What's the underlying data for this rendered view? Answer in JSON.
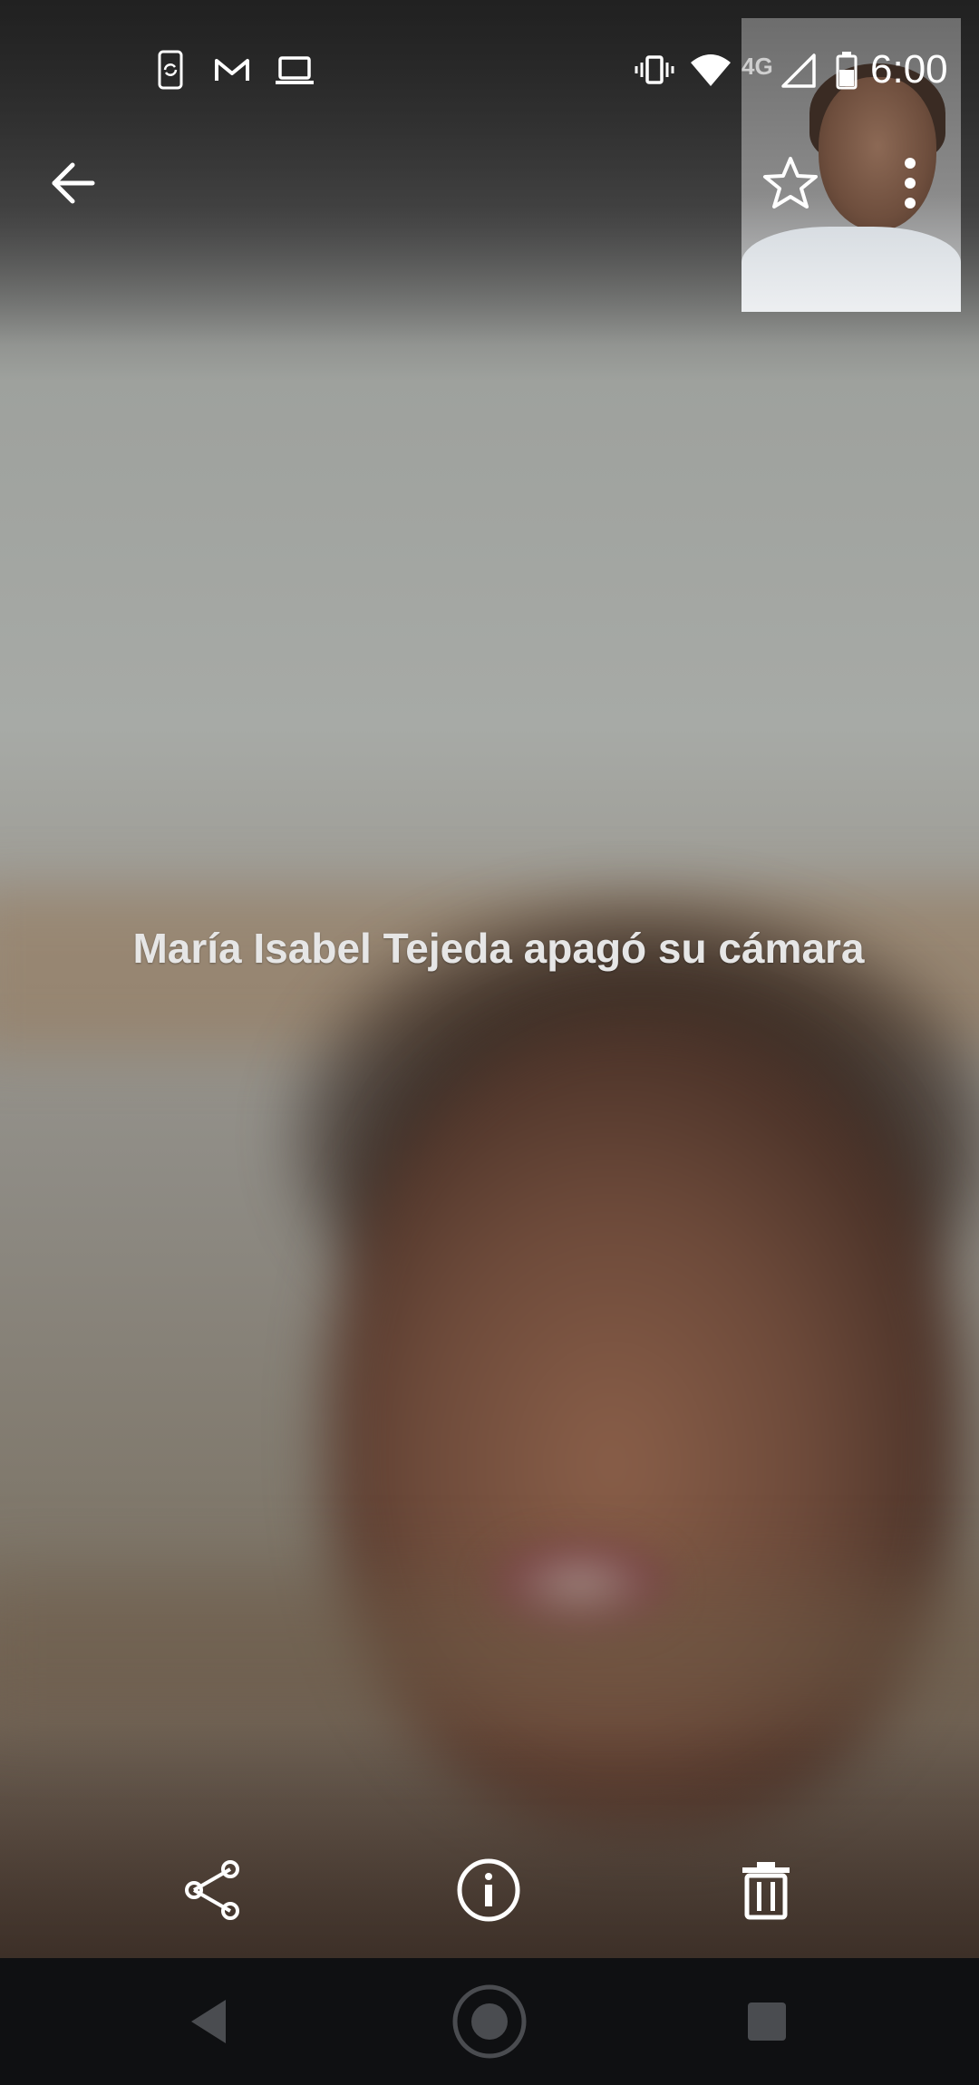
{
  "status_bar": {
    "time": "6:00",
    "network_label": "4G",
    "left_icons": [
      "phone-sync-icon",
      "gmail-icon",
      "laptop-icon"
    ],
    "right_icons": [
      "vibrate-icon",
      "wifi-icon",
      "signal-icon",
      "battery-icon"
    ]
  },
  "call": {
    "camera_off_message": "María Isabel Tejeda apagó su cámara"
  },
  "toolbar": {
    "back_icon": "arrow-back-icon",
    "favorite_icon": "star-outline-icon",
    "more_icon": "more-vert-icon"
  },
  "actions": [
    "share-icon",
    "info-icon",
    "delete-icon"
  ],
  "navigation": [
    "back-triangle-icon",
    "home-circle-icon",
    "recents-square-icon"
  ],
  "colors": {
    "icon": "#ffffff",
    "message_text": "#e6e6e6",
    "nav_bar": "#0f1012"
  }
}
